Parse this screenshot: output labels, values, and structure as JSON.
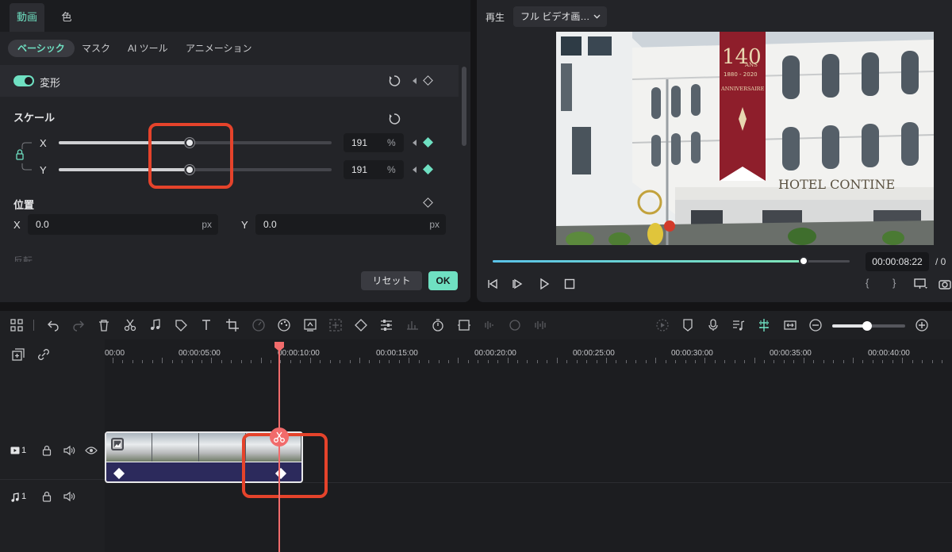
{
  "props": {
    "tabs": [
      "動画",
      "色"
    ],
    "subtabs": [
      "ベーシック",
      "マスク",
      "AI ツール",
      "アニメーション"
    ],
    "transform_label": "変形",
    "scale_label": "スケール",
    "x_label": "X",
    "y_label": "Y",
    "scale_x_value": "191",
    "scale_y_value": "191",
    "percent_unit": "%",
    "scale_x_level": 0.48,
    "scale_y_level": 0.48,
    "position_label": "位置",
    "pos_x_label": "X",
    "pos_x_value": "0.0",
    "pos_y_label": "Y",
    "pos_y_value": "0.0",
    "px_unit": "px",
    "flip_label": "反転",
    "reset_label": "リセット",
    "ok_label": "OK",
    "accent_color": "#6fe0c2"
  },
  "player": {
    "label": "再生",
    "quality": "フル ビデオ画…",
    "video_banner_line1": "140",
    "video_banner_ans": "ANS",
    "video_banner_years": "1880 - 2020",
    "video_banner_anniv": "ANNIVERSAIRE",
    "video_hotel_sign": "HOTEL CONTINE",
    "progress": 0.87,
    "timecode": "00:00:08:22",
    "timecode_sep": "/ 0",
    "bracket_in": "{",
    "bracket_out": "}"
  },
  "timeline": {
    "ruler_labels": [
      "00:00",
      "00:00:05:00",
      "00:00:10:00",
      "00:00:15:00",
      "00:00:20:00",
      "00:00:25:00",
      "00:00:30:00",
      "00:00:35:00",
      "00:00:40:00"
    ],
    "video_track_num": "1",
    "audio_track_num": "1",
    "zoom_level": 0.48
  }
}
